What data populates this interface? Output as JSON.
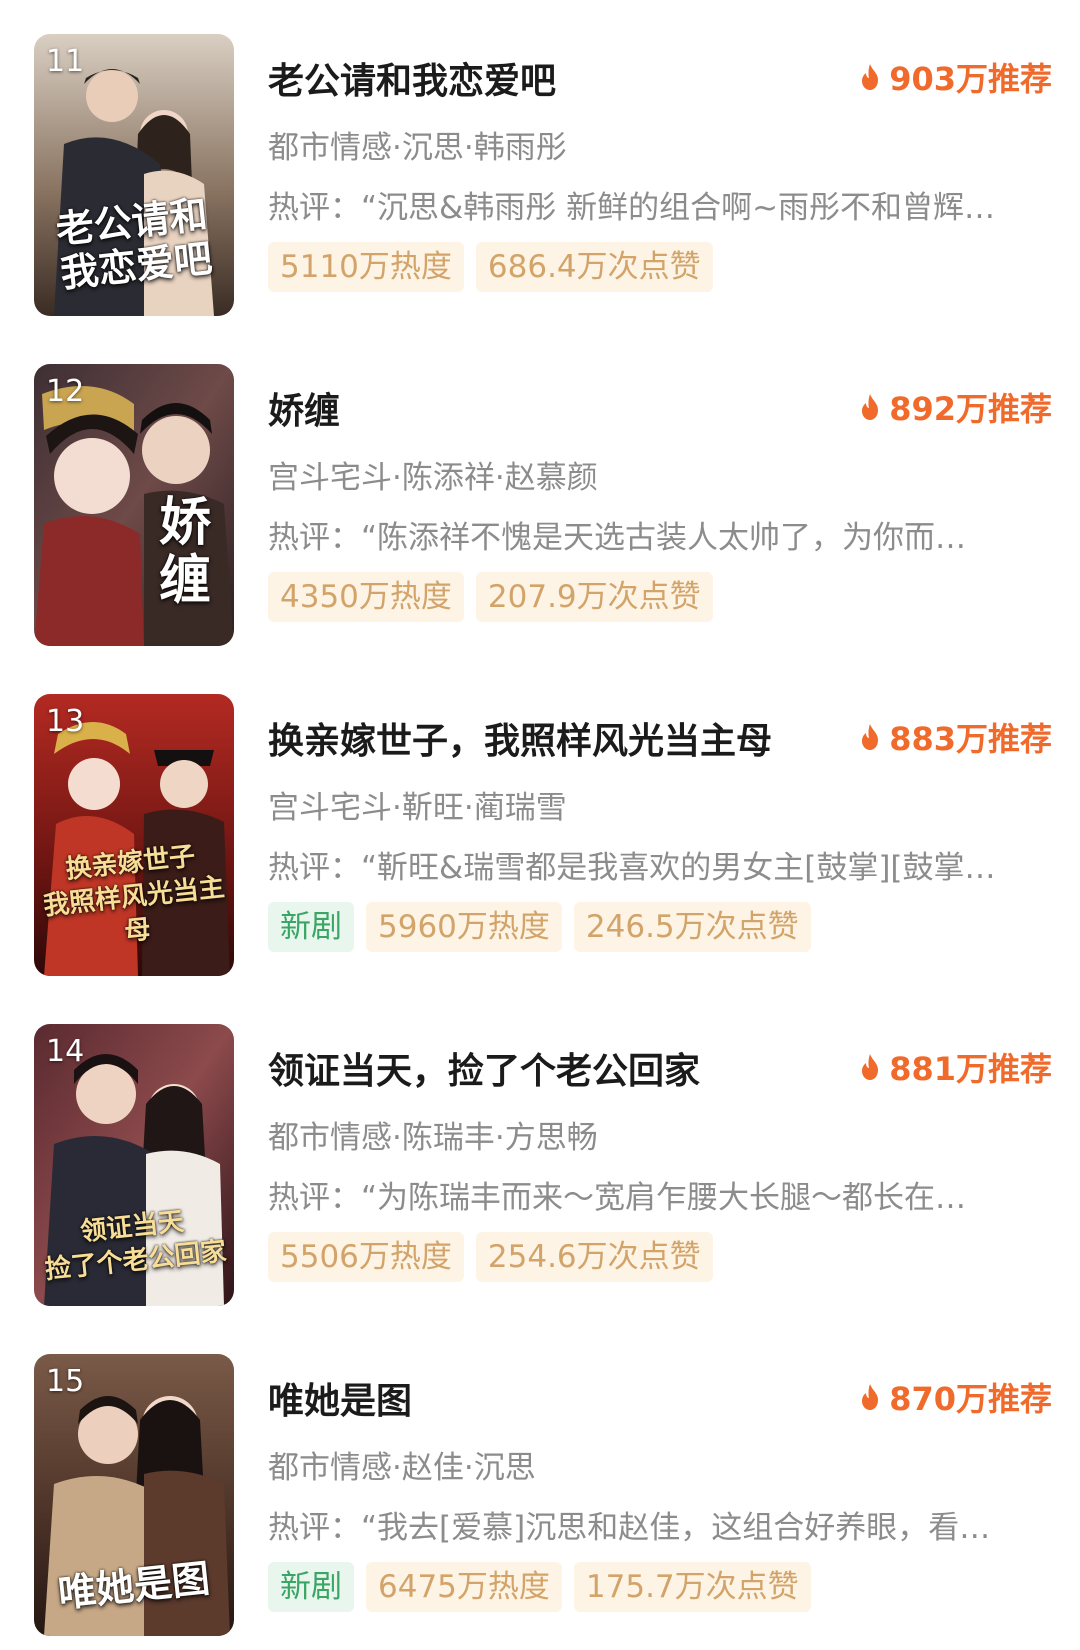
{
  "colors": {
    "accent": "#f06a2c",
    "meta_text": "#8c8c8c",
    "tag_warm_bg": "#fdf4e6",
    "tag_warm_text": "#d3a46a",
    "tag_new_bg": "#e9f6ee",
    "tag_new_text": "#3aa665"
  },
  "items": [
    {
      "rank": "11",
      "poster_title": "老公请和\n我恋爱吧",
      "title": "老公请和我恋爱吧",
      "recommend": "903万推荐",
      "recommend_icon": "fire-icon",
      "meta": "都市情感·沉思·韩雨彤",
      "comment": "热评：“沉思&韩雨彤 新鲜的组合啊~雨彤不和曾辉…",
      "new_tag": "",
      "heat": "5110万热度",
      "likes": "686.4万次点赞"
    },
    {
      "rank": "12",
      "poster_title": "娇\n缠",
      "title": "娇缠",
      "recommend": "892万推荐",
      "recommend_icon": "fire-icon",
      "meta": "宫斗宅斗·陈添祥·赵慕颜",
      "comment": "热评：“陈添祥不愧是天选古装人太帅了，为你而…",
      "new_tag": "",
      "heat": "4350万热度",
      "likes": "207.9万次点赞"
    },
    {
      "rank": "13",
      "poster_title": "换亲嫁世子\n我照样风光当主母",
      "title": "换亲嫁世子，我照样风光当主母",
      "recommend": "883万推荐",
      "recommend_icon": "fire-icon",
      "meta": "宫斗宅斗·靳旺·蔺瑞雪",
      "comment": "热评：“靳旺&瑞雪都是我喜欢的男女主[鼓掌][鼓掌…",
      "new_tag": "新剧",
      "heat": "5960万热度",
      "likes": "246.5万次点赞"
    },
    {
      "rank": "14",
      "poster_title": "领证当天\n捡了个老公回家",
      "title": "领证当天，捡了个老公回家",
      "recommend": "881万推荐",
      "recommend_icon": "fire-icon",
      "meta": "都市情感·陈瑞丰·方思畅",
      "comment": "热评：“为陈瑞丰而来～宽肩乍腰大长腿～都长在…",
      "new_tag": "",
      "heat": "5506万热度",
      "likes": "254.6万次点赞"
    },
    {
      "rank": "15",
      "poster_title": "唯她是图",
      "title": "唯她是图",
      "recommend": "870万推荐",
      "recommend_icon": "fire-icon",
      "meta": "都市情感·赵佳·沉思",
      "comment": "热评：“我去[爱慕]沉思和赵佳，这组合好养眼，看…",
      "new_tag": "新剧",
      "heat": "6475万热度",
      "likes": "175.7万次点赞"
    }
  ]
}
